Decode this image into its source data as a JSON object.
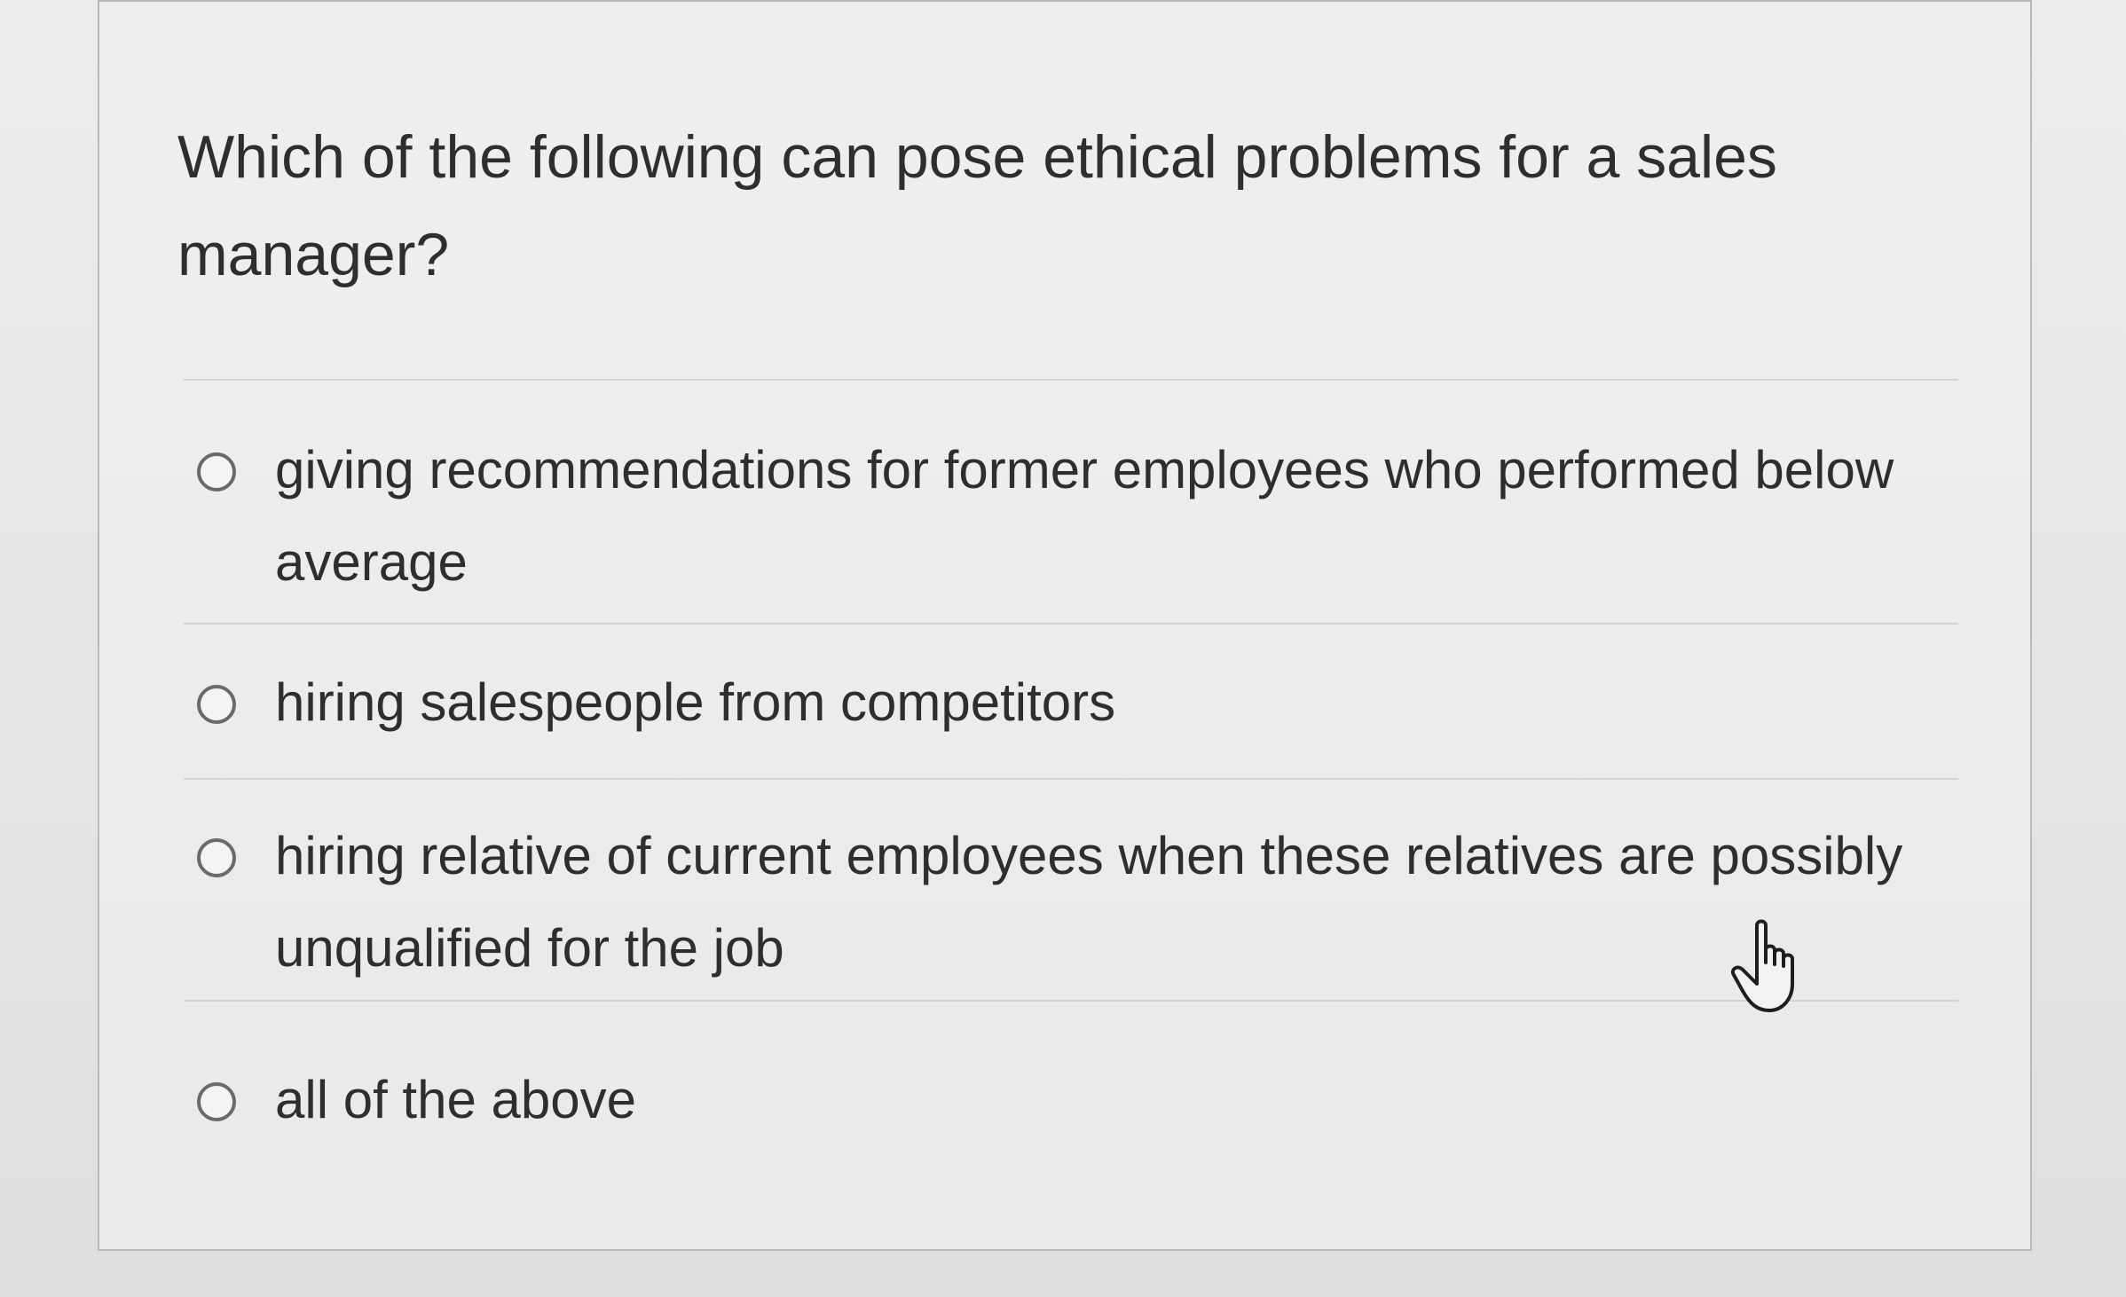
{
  "question": {
    "text": "Which of the following can pose ethical problems for a sales manager?"
  },
  "options": [
    {
      "label": "giving recommendations for former employees who performed below average",
      "selected": false
    },
    {
      "label": "hiring salespeople from competitors",
      "selected": false
    },
    {
      "label": "hiring relative of current employees when these relatives are possibly unqualified for the job",
      "selected": false
    },
    {
      "label": "all of the above",
      "selected": false
    }
  ],
  "cursor": {
    "icon": "hand-pointer-icon"
  }
}
